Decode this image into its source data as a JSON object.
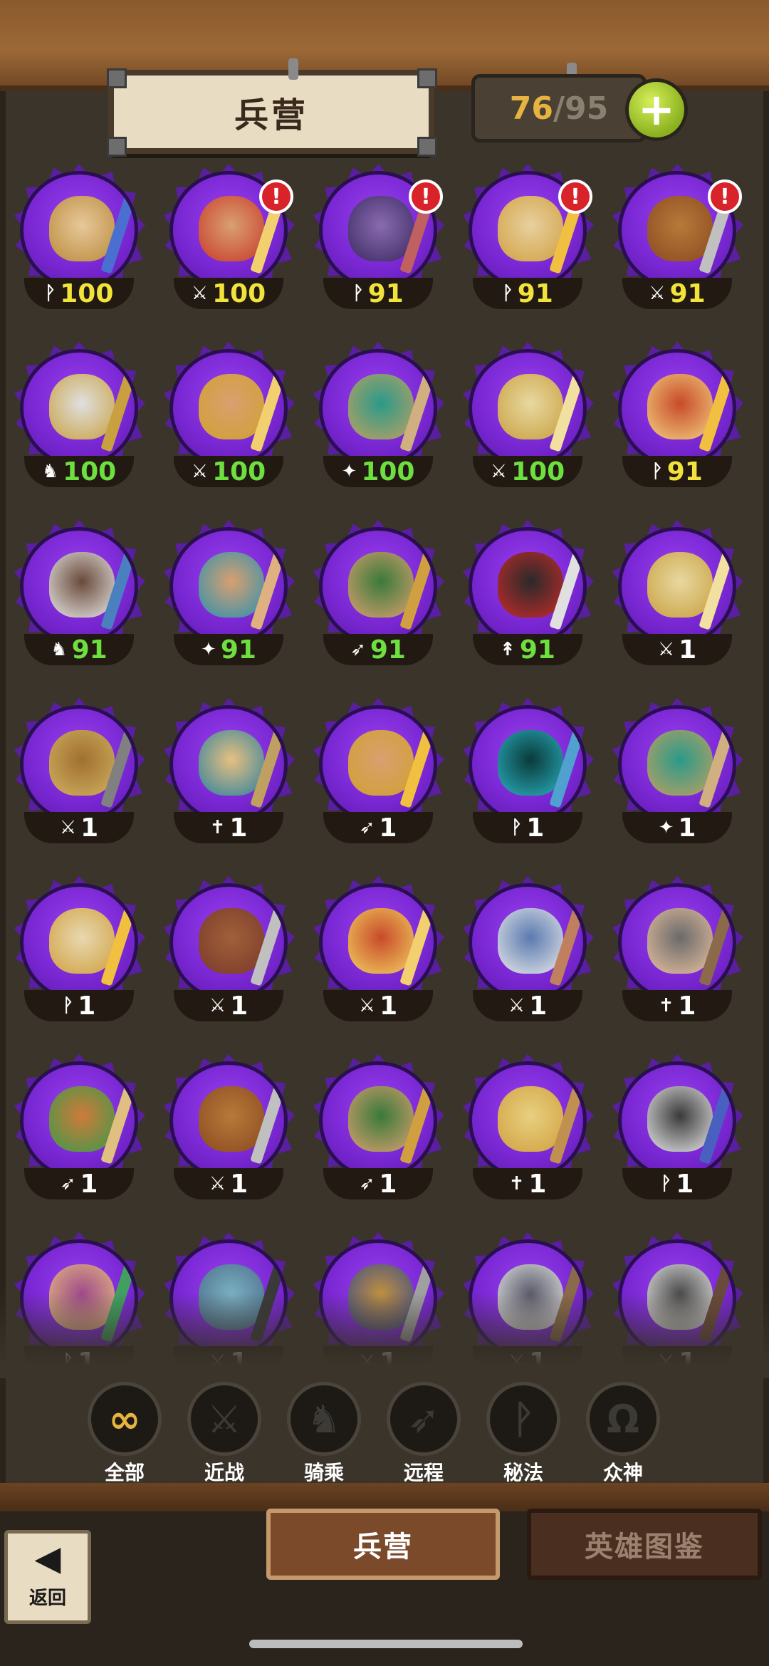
{
  "header": {
    "title": "兵营",
    "count_current": "76",
    "count_sep": "/",
    "count_max": "95",
    "add_label": "+"
  },
  "heroes": [
    {
      "cls": "ᚹ",
      "level": "100",
      "level_color": "#f2e33a",
      "skin": "#e8c89a",
      "accent": "#b88a3a",
      "prop": "#4a6fd0",
      "alert": false
    },
    {
      "cls": "⚔",
      "level": "100",
      "level_color": "#f2e33a",
      "skin": "#d9a070",
      "accent": "#c83a2a",
      "prop": "#f2d070",
      "alert": true
    },
    {
      "cls": "ᚹ",
      "level": "91",
      "level_color": "#f2e33a",
      "skin": "#8a6ab0",
      "accent": "#3a2a60",
      "prop": "#c06060",
      "alert": true
    },
    {
      "cls": "ᚹ",
      "level": "91",
      "level_color": "#f2e33a",
      "skin": "#e8d0a0",
      "accent": "#d0a040",
      "prop": "#f2c040",
      "alert": true
    },
    {
      "cls": "⚔",
      "level": "91",
      "level_color": "#f2e33a",
      "skin": "#b87a3a",
      "accent": "#8a4a20",
      "prop": "#c0c0c0",
      "alert": true
    },
    {
      "cls": "♞",
      "level": "100",
      "level_color": "#6de040",
      "skin": "#e0e0e0",
      "accent": "#c8a040",
      "prop": "#c8a040",
      "alert": false
    },
    {
      "cls": "⚔",
      "level": "100",
      "level_color": "#6de040",
      "skin": "#d9a070",
      "accent": "#d0a030",
      "prop": "#f2d070",
      "alert": false
    },
    {
      "cls": "✦",
      "level": "100",
      "level_color": "#6de040",
      "skin": "#2a9a8a",
      "accent": "#c0a060",
      "prop": "#d0b080",
      "alert": false
    },
    {
      "cls": "⚔",
      "level": "100",
      "level_color": "#6de040",
      "skin": "#e8d8a0",
      "accent": "#c8a040",
      "prop": "#f2e0a0",
      "alert": false
    },
    {
      "cls": "ᚹ",
      "level": "91",
      "level_color": "#f2e33a",
      "skin": "#c84a2a",
      "accent": "#f2d080",
      "prop": "#f2c040",
      "alert": false
    },
    {
      "cls": "♞",
      "level": "91",
      "level_color": "#6de040",
      "skin": "#6a4a3a",
      "accent": "#e8e8e8",
      "prop": "#4a80c0",
      "alert": false
    },
    {
      "cls": "✦",
      "level": "91",
      "level_color": "#6de040",
      "skin": "#d9a070",
      "accent": "#2a90b0",
      "prop": "#e0b080",
      "alert": false
    },
    {
      "cls": "➶",
      "level": "91",
      "level_color": "#6de040",
      "skin": "#3a7a3a",
      "accent": "#d9a070",
      "prop": "#d0a040",
      "alert": false
    },
    {
      "cls": "↟",
      "level": "91",
      "level_color": "#6de040",
      "skin": "#2a2a2a",
      "accent": "#c82a2a",
      "prop": "#e0e0e0",
      "alert": false
    },
    {
      "cls": "⚔",
      "level": "1",
      "level_color": "#ffffff",
      "skin": "#e8d8a0",
      "accent": "#c8a040",
      "prop": "#f2e0a0",
      "alert": false
    },
    {
      "cls": "⚔",
      "level": "1",
      "level_color": "#ffffff",
      "skin": "#a07030",
      "accent": "#d0b060",
      "prop": "#808080",
      "alert": false
    },
    {
      "cls": "✝",
      "level": "1",
      "level_color": "#ffffff",
      "skin": "#e8c080",
      "accent": "#2a80a0",
      "prop": "#c0a060",
      "alert": false
    },
    {
      "cls": "➶",
      "level": "1",
      "level_color": "#ffffff",
      "skin": "#d9a070",
      "accent": "#d0a030",
      "prop": "#f2c040",
      "alert": false
    },
    {
      "cls": "ᚹ",
      "level": "1",
      "level_color": "#ffffff",
      "skin": "#0a3a3a",
      "accent": "#2ab0c0",
      "prop": "#50a0d0",
      "alert": false
    },
    {
      "cls": "✦",
      "level": "1",
      "level_color": "#ffffff",
      "skin": "#2a9a8a",
      "accent": "#c0a060",
      "prop": "#d0b080",
      "alert": false
    },
    {
      "cls": "ᚹ",
      "level": "1",
      "level_color": "#ffffff",
      "skin": "#e8d8b0",
      "accent": "#d0a040",
      "prop": "#f2c040",
      "alert": false
    },
    {
      "cls": "⚔",
      "level": "1",
      "level_color": "#ffffff",
      "skin": "#a0603a",
      "accent": "#7a3a2a",
      "prop": "#c0c0c0",
      "alert": false
    },
    {
      "cls": "⚔",
      "level": "1",
      "level_color": "#ffffff",
      "skin": "#c84a2a",
      "accent": "#f2d060",
      "prop": "#f2d070",
      "alert": false
    },
    {
      "cls": "⚔",
      "level": "1",
      "level_color": "#ffffff",
      "skin": "#5a7ab0",
      "accent": "#e8e8e8",
      "prop": "#c08060",
      "alert": false
    },
    {
      "cls": "✝",
      "level": "1",
      "level_color": "#ffffff",
      "skin": "#6a6a6a",
      "accent": "#e8c0a0",
      "prop": "#8a6a4a",
      "alert": false
    },
    {
      "cls": "➶",
      "level": "1",
      "level_color": "#ffffff",
      "skin": "#d07a3a",
      "accent": "#3a9a4a",
      "prop": "#e0c080",
      "alert": false
    },
    {
      "cls": "⚔",
      "level": "1",
      "level_color": "#ffffff",
      "skin": "#b87a3a",
      "accent": "#8a4a20",
      "prop": "#c0c0c0",
      "alert": false
    },
    {
      "cls": "➶",
      "level": "1",
      "level_color": "#ffffff",
      "skin": "#3a7a3a",
      "accent": "#d9a070",
      "prop": "#d0a040",
      "alert": false
    },
    {
      "cls": "✝",
      "level": "1",
      "level_color": "#ffffff",
      "skin": "#e8d080",
      "accent": "#d0a040",
      "prop": "#c09050",
      "alert": false
    },
    {
      "cls": "ᚹ",
      "level": "1",
      "level_color": "#ffffff",
      "skin": "#3a3a3a",
      "accent": "#e8e8e8",
      "prop": "#4a60c0",
      "alert": false
    },
    {
      "cls": "ᚹ",
      "level": "1",
      "level_color": "#ffffff",
      "skin": "#a04a8a",
      "accent": "#e8c080",
      "prop": "#40a060",
      "alert": false
    },
    {
      "cls": "⚔",
      "level": "1",
      "level_color": "#ffffff",
      "skin": "#7ab0c0",
      "accent": "#4a6a8a",
      "prop": "#3a3a3a",
      "alert": false
    },
    {
      "cls": "⚔",
      "level": "1",
      "level_color": "#ffffff",
      "skin": "#c09040",
      "accent": "#3a4a8a",
      "prop": "#a0a0a0",
      "alert": false
    },
    {
      "cls": "⚔",
      "level": "1",
      "level_color": "#ffffff",
      "skin": "#5a5a6a",
      "accent": "#e8e8e8",
      "prop": "#8a6a4a",
      "alert": false
    },
    {
      "cls": "⚔",
      "level": "1",
      "level_color": "#ffffff",
      "skin": "#4a4a4a",
      "accent": "#e8e8e8",
      "prop": "#6a4a3a",
      "alert": false
    }
  ],
  "filters": [
    {
      "label": "全部",
      "icon": "∞",
      "icon_name": "infinity-icon",
      "active": true
    },
    {
      "label": "近战",
      "icon": "⚔",
      "icon_name": "sword-icon",
      "active": false
    },
    {
      "label": "骑乘",
      "icon": "♞",
      "icon_name": "horse-icon",
      "active": false
    },
    {
      "label": "远程",
      "icon": "➶",
      "icon_name": "bow-icon",
      "active": false
    },
    {
      "label": "秘法",
      "icon": "ᚹ",
      "icon_name": "rune-icon",
      "active": false
    },
    {
      "label": "众神",
      "icon": "Ω",
      "icon_name": "omega-icon",
      "active": false
    }
  ],
  "tabs": {
    "barracks": "兵营",
    "codex": "英雄图鉴"
  },
  "back": {
    "arrow": "◀",
    "label": "返回"
  }
}
